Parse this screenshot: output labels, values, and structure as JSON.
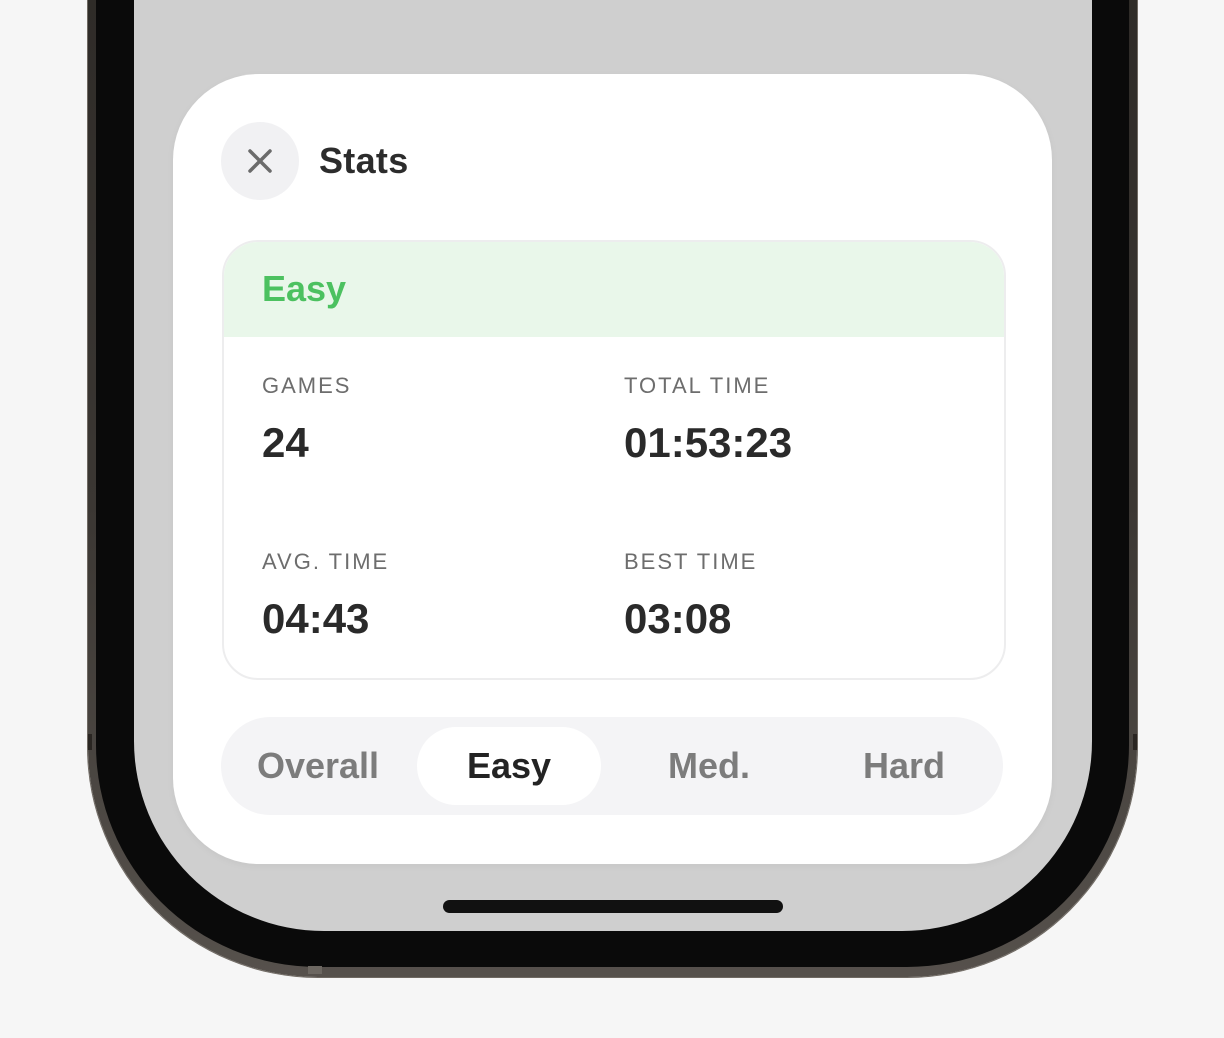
{
  "sheet": {
    "title": "Stats",
    "close_icon": "close-icon"
  },
  "card": {
    "header_label": "Easy",
    "accent_color": "#4cc160",
    "header_bg": "#e9f7ea",
    "stats": {
      "games_label": "GAMES",
      "games_value": "24",
      "total_time_label": "TOTAL TIME",
      "total_time_value": "01:53:23",
      "avg_time_label": "AVG. TIME",
      "avg_time_value": "04:43",
      "best_time_label": "BEST TIME",
      "best_time_value": "03:08"
    }
  },
  "segmented": {
    "options": [
      "Overall",
      "Easy",
      "Med.",
      "Hard"
    ],
    "selected": "Easy"
  }
}
